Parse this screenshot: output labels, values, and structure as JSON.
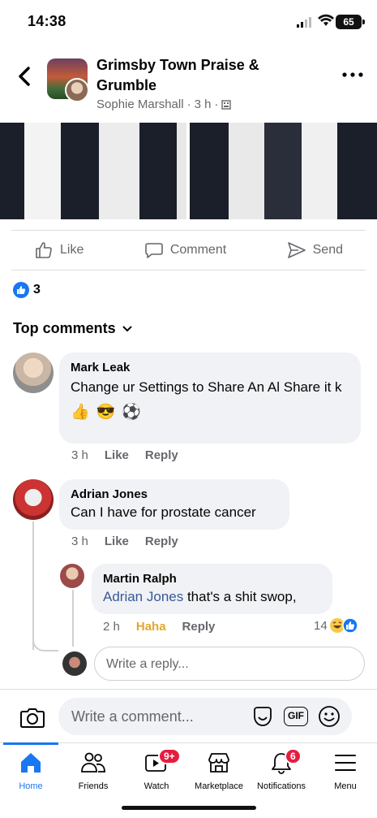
{
  "status": {
    "time": "14:38",
    "battery": "65"
  },
  "header": {
    "group_name": "Grimsby Town Praise & Grumble",
    "author": "Sophie Marshall",
    "time": "3 h",
    "separator": "·"
  },
  "actions": {
    "like": "Like",
    "comment": "Comment",
    "send": "Send"
  },
  "reactions": {
    "count": "3"
  },
  "top_comments_label": "Top comments",
  "comments": [
    {
      "name": "Mark Leak",
      "text": "Change ur Settings to Share An Al Share it k",
      "emoji": [
        "👍",
        "😎",
        "⚽"
      ],
      "time": "3 h",
      "like": "Like",
      "reply": "Reply"
    },
    {
      "name": "Adrian Jones",
      "text": "Can I have for prostate cancer",
      "time": "3 h",
      "like": "Like",
      "reply": "Reply"
    }
  ],
  "reply": {
    "name": "Martin Ralph",
    "mention": "Adrian Jones",
    "text": " that's a shit swop,",
    "time": "2 h",
    "reaction_label": "Haha",
    "reply": "Reply",
    "reaction_count": "14"
  },
  "reply_box_placeholder": "Write a reply...",
  "composer_placeholder": "Write a comment...",
  "composer_gif": "GIF",
  "tabs": [
    {
      "label": "Home"
    },
    {
      "label": "Friends"
    },
    {
      "label": "Watch",
      "badge": "9+"
    },
    {
      "label": "Marketplace"
    },
    {
      "label": "Notifications",
      "badge": "6"
    },
    {
      "label": "Menu"
    }
  ],
  "colors": {
    "accent": "#1877f2",
    "badge": "#e41e3f",
    "haha": "#e5a62a",
    "mention": "#385898"
  }
}
